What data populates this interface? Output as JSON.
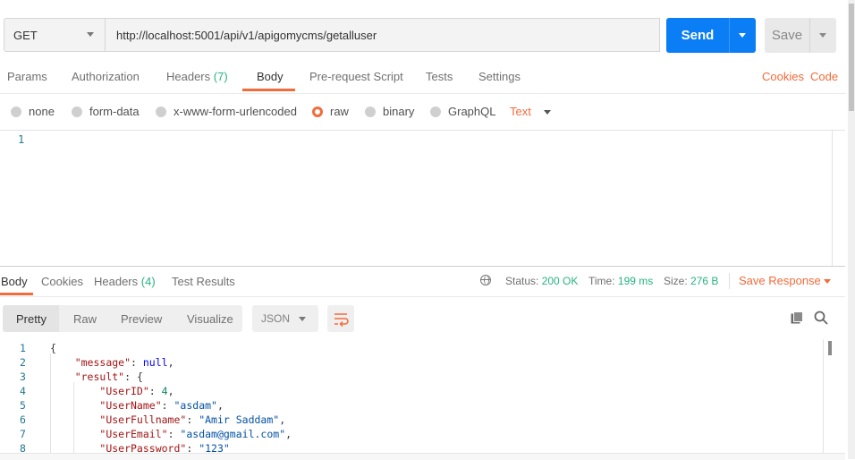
{
  "request": {
    "method": "GET",
    "url": "http://localhost:5001/api/v1/apigomycms/getalluser",
    "send_label": "Send",
    "save_label": "Save"
  },
  "req_tabs": {
    "params": "Params",
    "authorization": "Authorization",
    "headers": "Headers",
    "headers_count": "(7)",
    "body": "Body",
    "prerequest": "Pre-request Script",
    "tests": "Tests",
    "settings": "Settings",
    "cookies": "Cookies",
    "code": "Code"
  },
  "body_types": {
    "none": "none",
    "form_data": "form-data",
    "urlencoded": "x-www-form-urlencoded",
    "raw": "raw",
    "binary": "binary",
    "graphql": "GraphQL",
    "text": "Text",
    "selected": "raw"
  },
  "editor": {
    "line1": "1"
  },
  "resp_tabs": {
    "body": "Body",
    "cookies": "Cookies",
    "headers": "Headers",
    "headers_count": "(4)",
    "test_results": "Test Results"
  },
  "status": {
    "status_label": "Status:",
    "status_value": "200 OK",
    "time_label": "Time:",
    "time_value": "199 ms",
    "size_label": "Size:",
    "size_value": "276 B",
    "save_response": "Save Response"
  },
  "resp_view": {
    "pretty": "Pretty",
    "raw": "Raw",
    "preview": "Preview",
    "visualize": "Visualize",
    "format": "JSON"
  },
  "response_lines": [
    {
      "n": "1",
      "parts": [
        [
          "p",
          "{"
        ]
      ]
    },
    {
      "n": "2",
      "parts": [
        [
          "p",
          "    "
        ],
        [
          "k",
          "\"message\""
        ],
        [
          "p",
          ": "
        ],
        [
          "b",
          "null"
        ],
        [
          "p",
          ","
        ]
      ]
    },
    {
      "n": "3",
      "parts": [
        [
          "p",
          "    "
        ],
        [
          "k",
          "\"result\""
        ],
        [
          "p",
          ": {"
        ]
      ]
    },
    {
      "n": "4",
      "parts": [
        [
          "p",
          "        "
        ],
        [
          "k",
          "\"UserID\""
        ],
        [
          "p",
          ": "
        ],
        [
          "n",
          "4"
        ],
        [
          "p",
          ","
        ]
      ]
    },
    {
      "n": "5",
      "parts": [
        [
          "p",
          "        "
        ],
        [
          "k",
          "\"UserName\""
        ],
        [
          "p",
          ": "
        ],
        [
          "s",
          "\"asdam\""
        ],
        [
          "p",
          ","
        ]
      ]
    },
    {
      "n": "6",
      "parts": [
        [
          "p",
          "        "
        ],
        [
          "k",
          "\"UserFullname\""
        ],
        [
          "p",
          ": "
        ],
        [
          "s",
          "\"Amir Saddam\""
        ],
        [
          "p",
          ","
        ]
      ]
    },
    {
      "n": "7",
      "parts": [
        [
          "p",
          "        "
        ],
        [
          "k",
          "\"UserEmail\""
        ],
        [
          "p",
          ": "
        ],
        [
          "s",
          "\"asdam@gmail.com\""
        ],
        [
          "p",
          ","
        ]
      ]
    },
    {
      "n": "8",
      "parts": [
        [
          "p",
          "        "
        ],
        [
          "k",
          "\"UserPassword\""
        ],
        [
          "p",
          ": "
        ],
        [
          "s",
          "\"123\""
        ]
      ]
    }
  ]
}
